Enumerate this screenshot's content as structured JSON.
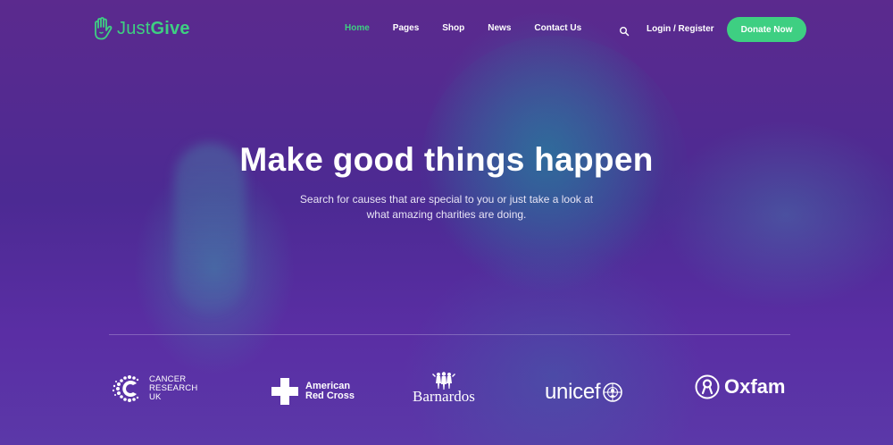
{
  "brand": {
    "name_part1": "Just",
    "name_part2": "Give",
    "accent": "#3ecf82",
    "logo_icon": "hand-icon"
  },
  "nav": {
    "items": [
      {
        "label": "Home",
        "active": true
      },
      {
        "label": "Pages",
        "active": false
      },
      {
        "label": "Shop",
        "active": false
      },
      {
        "label": "News",
        "active": false
      },
      {
        "label": "Contact Us",
        "active": false
      }
    ],
    "search_icon": "search-icon",
    "login_label": "Login / Register",
    "donate_label": "Donate Now"
  },
  "hero": {
    "headline": "Make good things happen",
    "subtext_line1": "Search for causes that are special to you or just take a look at",
    "subtext_line2": "what amazing charities are doing.",
    "overlay_color": "#5b2a8e"
  },
  "partners": {
    "cancer": {
      "line1": "CANCER",
      "line2": "RESEARCH",
      "line3": "UK",
      "icon": "cancer-research-logo-icon"
    },
    "redcross": {
      "line1": "American",
      "line2": "Red Cross",
      "icon": "red-cross-icon"
    },
    "barnardos": {
      "name": "Barnardos",
      "icon": "barnardos-figures-icon"
    },
    "unicef": {
      "name": "unicef",
      "icon": "unicef-globe-icon"
    },
    "oxfam": {
      "name": "Oxfam",
      "icon": "oxfam-circle-icon"
    }
  }
}
